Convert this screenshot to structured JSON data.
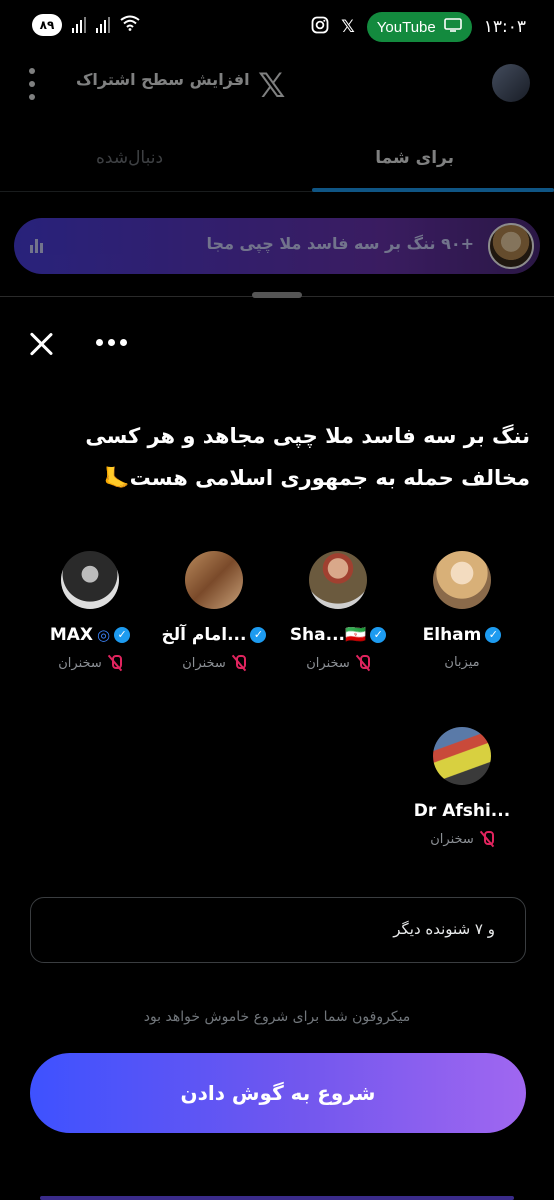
{
  "status_bar": {
    "battery": "۸۹",
    "youtube_label": "YouTube",
    "time": "۱۳:۰۳"
  },
  "header": {
    "upgrade_label": "افزایش سطح اشتراک",
    "logo": "𝕏"
  },
  "tabs": {
    "for_you": "برای شما",
    "following": "دنبال‌شده"
  },
  "space_pill": {
    "text": "+۹۰ ننگ بر سه فاسد ملا چپی مجا"
  },
  "sheet": {
    "title": "ننگ بر سه فاسد ملا چپی مجاهد و هر کسی مخالف حمله به جمهوری اسلامی هست🦶",
    "participants": [
      {
        "name": "Elham",
        "role": "میزبان",
        "verified": true,
        "muted": false,
        "avatar_color": "#c9a37a"
      },
      {
        "name": "Sha...🇮🇷",
        "role": "سخنران",
        "verified": true,
        "muted": true,
        "avatar_color": "#6b5a3e"
      },
      {
        "name": "امام آلخ...",
        "role": "سخنران",
        "verified": true,
        "muted": true,
        "avatar_color": "#8a5a3a"
      },
      {
        "name": "MAX",
        "role": "سخنران",
        "verified": true,
        "muted": true,
        "avatar_color": "#3a3a3a"
      },
      {
        "name": "Dr Afshi...",
        "role": "سخنران",
        "verified": false,
        "muted": true,
        "avatar_color": "#4a6a8a"
      }
    ],
    "listeners": "و ۷ شنونده دیگر",
    "mic_note": "میکروفون شما برای شروع خاموش خواهد بود",
    "start_button": "شروع به گوش دادن"
  },
  "colors": {
    "accent": "#1d9bf0",
    "button_start": "#3e52ff",
    "button_end": "#a067f0",
    "muted_mic": "#e0245e"
  }
}
